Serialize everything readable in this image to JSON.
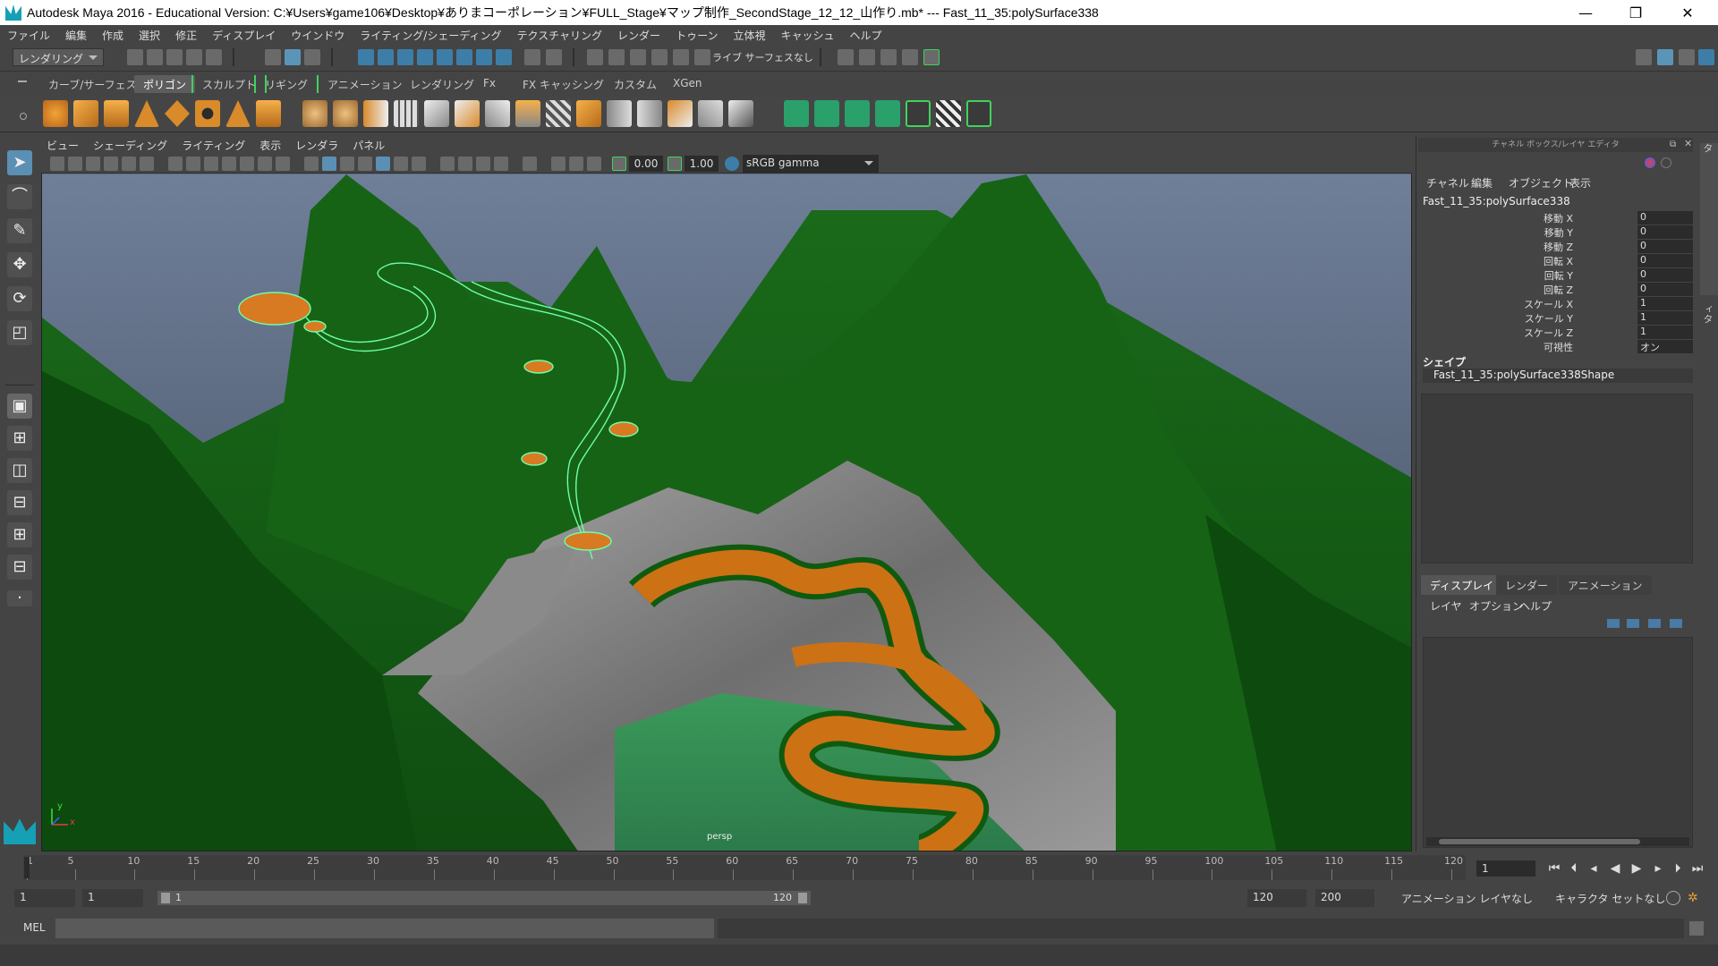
{
  "window": {
    "title": "Autodesk Maya 2016 - Educational Version: C:¥Users¥game106¥Desktop¥ありまコーポレーション¥FULL_Stage¥マップ制作_SecondStage_12_12_山作り.mb*   ---   Fast_11_35:polySurface338",
    "minimize": "—",
    "restore": "❐",
    "close": "✕"
  },
  "menubar": [
    "ファイル",
    "編集",
    "作成",
    "選択",
    "修正",
    "ディスプレイ",
    "ウインドウ",
    "ライティング/シェーディング",
    "テクスチャリング",
    "レンダー",
    "トゥーン",
    "立体視",
    "キャッシュ",
    "ヘルプ"
  ],
  "statusline": {
    "mode": "レンダリング",
    "live_surface": "ライブ サーフェスなし"
  },
  "shelf_tabs": [
    "カーブ/サーフェス",
    "ポリゴン",
    "スカルプト",
    "リギング",
    "アニメーション",
    "レンダリング",
    "Fx",
    "FX キャッシング",
    "カスタム",
    "XGen"
  ],
  "viewport": {
    "menu": [
      "ビュー",
      "シェーディング",
      "ライティング",
      "表示",
      "レンダラ",
      "パネル"
    ],
    "exposure": "0.00",
    "gamma": "1.00",
    "color_space": "sRGB gamma",
    "camera": "persp",
    "axis_x": "x",
    "axis_y": "y"
  },
  "channel_box": {
    "header": "チャネル ボックス/レイヤ エディタ",
    "menu": [
      "チャネル",
      "編集",
      "オブジェクト",
      "表示"
    ],
    "object": "Fast_11_35:polySurface338",
    "attributes": [
      {
        "label": "移動 X",
        "value": "0"
      },
      {
        "label": "移動 Y",
        "value": "0"
      },
      {
        "label": "移動 Z",
        "value": "0"
      },
      {
        "label": "回転 X",
        "value": "0"
      },
      {
        "label": "回転 Y",
        "value": "0"
      },
      {
        "label": "回転 Z",
        "value": "0"
      },
      {
        "label": "スケール X",
        "value": "1"
      },
      {
        "label": "スケール Y",
        "value": "1"
      },
      {
        "label": "スケール Z",
        "value": "1"
      },
      {
        "label": "可視性",
        "value": "オン"
      }
    ],
    "shape_header": "シェイプ",
    "shape_name": "Fast_11_35:polySurface338Shape",
    "layer_tabs": [
      "ディスプレイ",
      "レンダー",
      "アニメーション"
    ],
    "layer_menu": [
      "レイヤ",
      "オプション",
      "ヘルプ"
    ],
    "side_tabs": [
      "チャネル ボックス/レイヤ エディタ",
      "アトリビュート エディタ"
    ]
  },
  "timeline": {
    "ticks": [
      "1",
      "5",
      "10",
      "15",
      "20",
      "25",
      "30",
      "35",
      "40",
      "45",
      "50",
      "55",
      "60",
      "65",
      "70",
      "75",
      "80",
      "85",
      "90",
      "95",
      "100",
      "105",
      "110",
      "115",
      "120"
    ],
    "current_frame": "1"
  },
  "range": {
    "start": "1",
    "playback_start": "1",
    "slider_start": "1",
    "slider_end": "120",
    "playback_end": "120",
    "end": "200",
    "anim_layer": "アニメーション レイヤなし",
    "character": "キャラクタ セットなし"
  },
  "command": {
    "lang": "MEL"
  }
}
